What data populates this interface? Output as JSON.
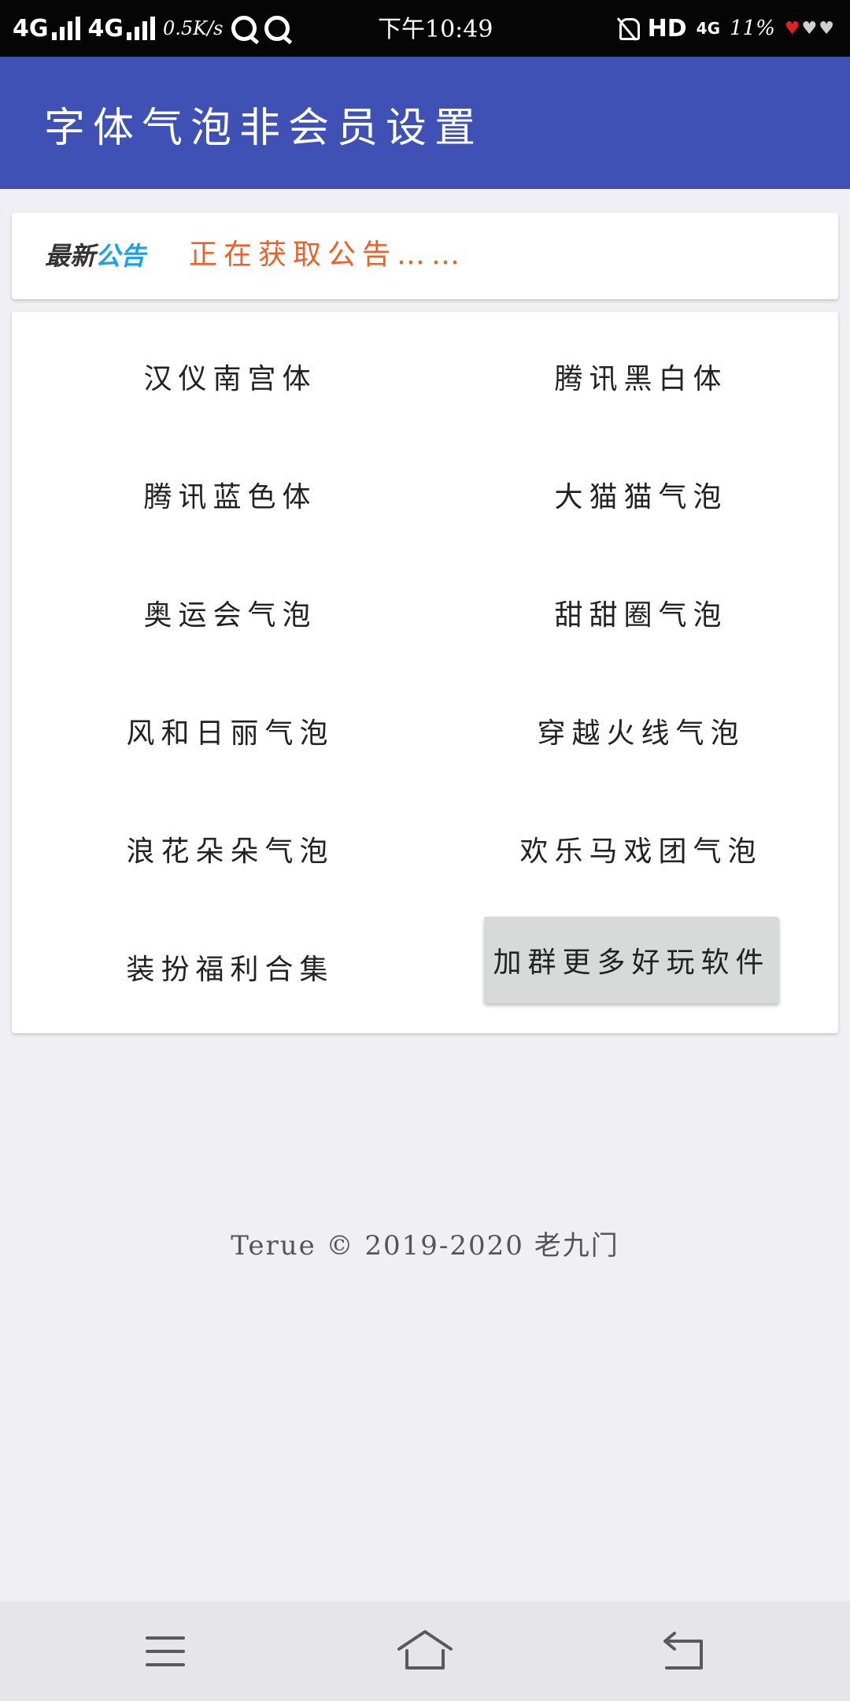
{
  "status_bar": {
    "net1": "4G",
    "net2": "4G",
    "speed": "0.5K/s",
    "time": "下午10:49",
    "hd": "HD",
    "net3": "4G",
    "battery": "11%"
  },
  "app_bar": {
    "title": "字体气泡非会员设置"
  },
  "notice": {
    "logo_part1": "最新",
    "logo_part2": "公告",
    "text": "正在获取公告……"
  },
  "grid": {
    "items": [
      "汉仪南宫体",
      "腾讯黑白体",
      "腾讯蓝色体",
      "大猫猫气泡",
      "奥运会气泡",
      "甜甜圈气泡",
      "风和日丽气泡",
      "穿越火线气泡",
      "浪花朵朵气泡",
      "欢乐马戏团气泡",
      "装扮福利合集",
      "加群更多好玩软件"
    ]
  },
  "footer": {
    "text": "Terue © 2019-2020 老九门"
  },
  "colors": {
    "app_bar": "#3f51b5",
    "notice_text": "#e8622a",
    "logo_blue": "#1aa3e8"
  },
  "icons": {
    "nav": [
      "menu-icon",
      "home-icon",
      "back-icon"
    ]
  }
}
